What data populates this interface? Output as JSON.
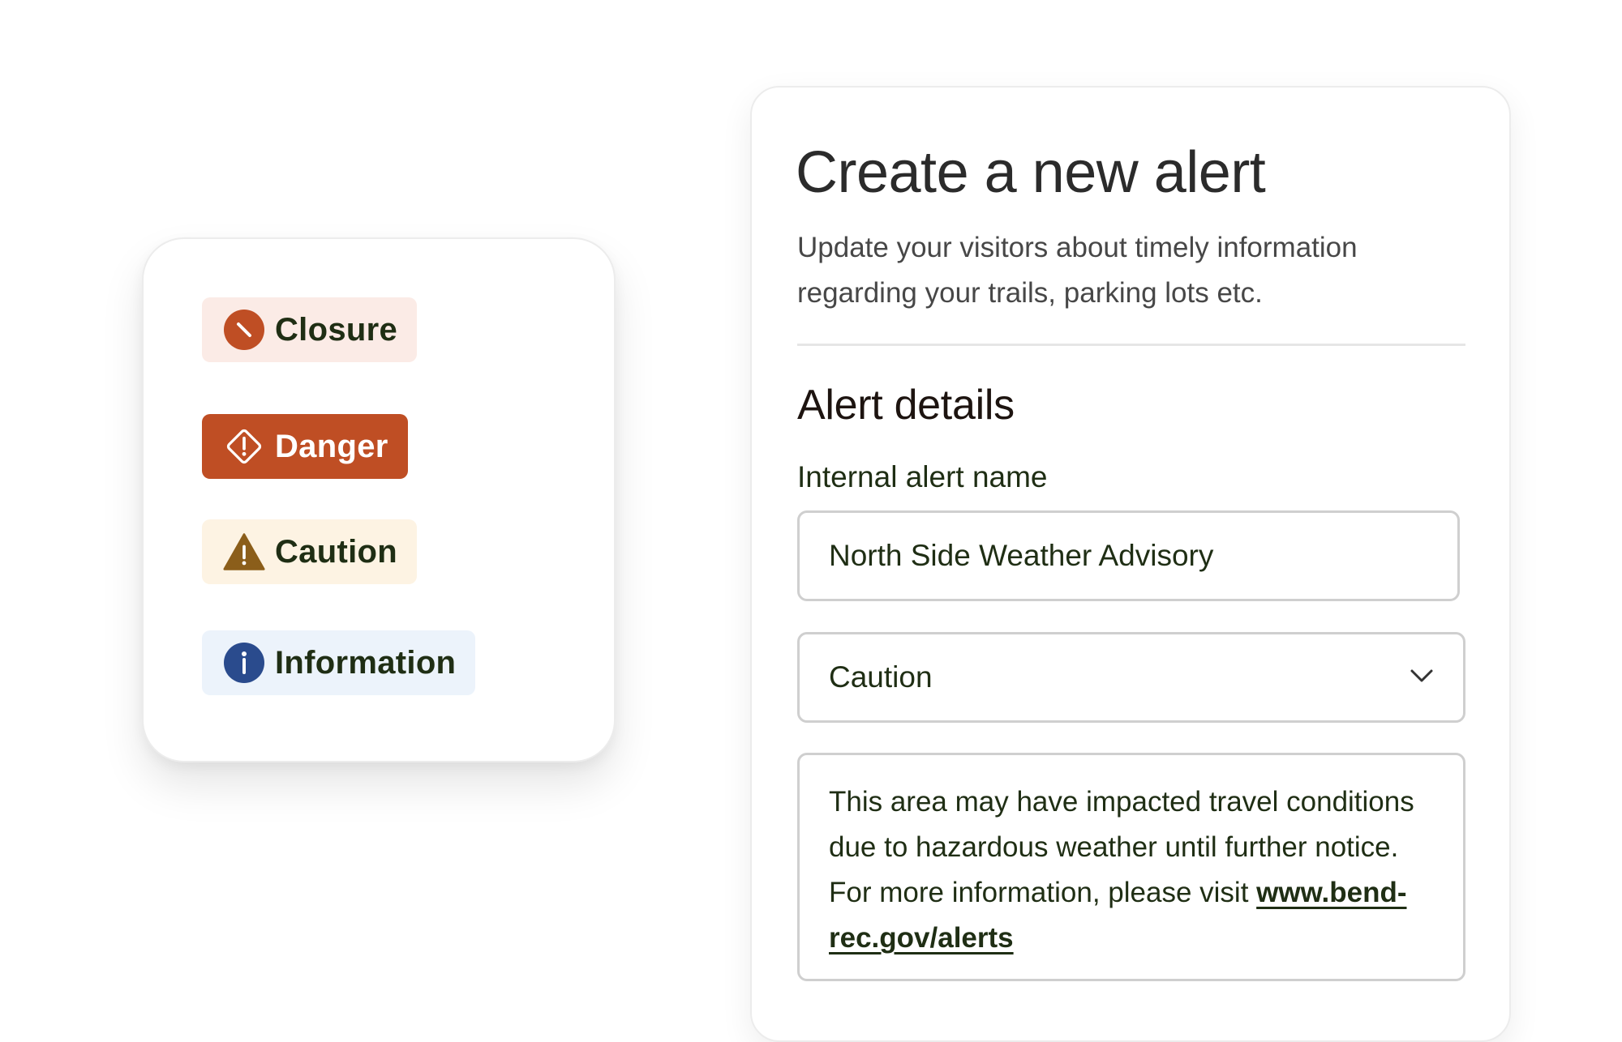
{
  "badges": {
    "closure": {
      "label": "Closure",
      "icon": "closure-icon"
    },
    "danger": {
      "label": "Danger",
      "icon": "danger-diamond-icon"
    },
    "caution": {
      "label": "Caution",
      "icon": "warning-triangle-icon"
    },
    "information": {
      "label": "Information",
      "icon": "info-icon"
    }
  },
  "form": {
    "title": "Create a new alert",
    "subtitle": "Update your visitors about timely information regarding your trails, parking lots etc.",
    "section_title": "Alert details",
    "name_label": "Internal alert name",
    "name_value": "North Side Weather Advisory",
    "type_value": "Caution",
    "message_text": "This area may have impacted travel conditions due to hazardous weather until further notice. For more information, please visit ",
    "message_link": "www.bend-rec.gov/alerts"
  },
  "colors": {
    "closure_bg": "#fbebe6",
    "closure_icon": "#bf4e24",
    "danger_bg": "#bf4e24",
    "caution_bg": "#fdf3e3",
    "caution_icon": "#8b5e1a",
    "info_bg": "#ecf3fb",
    "info_icon": "#2a4b8d",
    "text_dark_green": "#1f2e14"
  }
}
